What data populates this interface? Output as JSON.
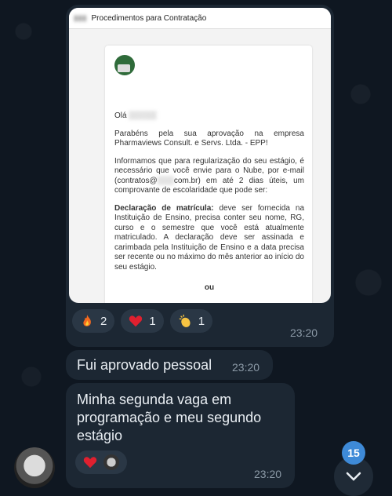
{
  "photo_message": {
    "doc_header": "Procedimentos para Contratação",
    "greeting": "Olá",
    "paragraphs": [
      "Parabéns pela sua aprovação na empresa Pharmaviews Consult. e Servs. Ltda. - EPP!",
      "Informamos que para regularização do seu estágio, é necessário que você envie para o Nube, por e-mail (contratos@",
      "com.br) em até 2 dias úteis, um comprovante de escolaridade que pode ser:"
    ],
    "declaracao_title": "Declaração de matrícula:",
    "declaracao_text": "deve ser fornecida na Instituição de Ensino, precisa conter seu nome, RG, curso e o semestre que você está atualmente matriculado. A declaração deve ser assinada e carimbada pela Instituição de Ensino e a data precisa ser recente ou no máximo do mês anterior ao início do seu estágio.",
    "ou": "ou",
    "reactions": [
      {
        "emoji": "fire",
        "count": "2"
      },
      {
        "emoji": "heart",
        "count": "1"
      },
      {
        "emoji": "clap",
        "count": "1"
      }
    ],
    "time": "23:20"
  },
  "message2": {
    "text": "Fui aprovado pessoal",
    "time": "23:20"
  },
  "message3": {
    "text_line1": "Minha segunda vaga em",
    "text_line2": "programação e meu segundo",
    "text_line3": "estágio",
    "time": "23:20"
  },
  "unread_count": "15",
  "colors": {
    "bubble": "#1c2733",
    "accent": "#3e8ad7",
    "background": "#0f1721"
  }
}
